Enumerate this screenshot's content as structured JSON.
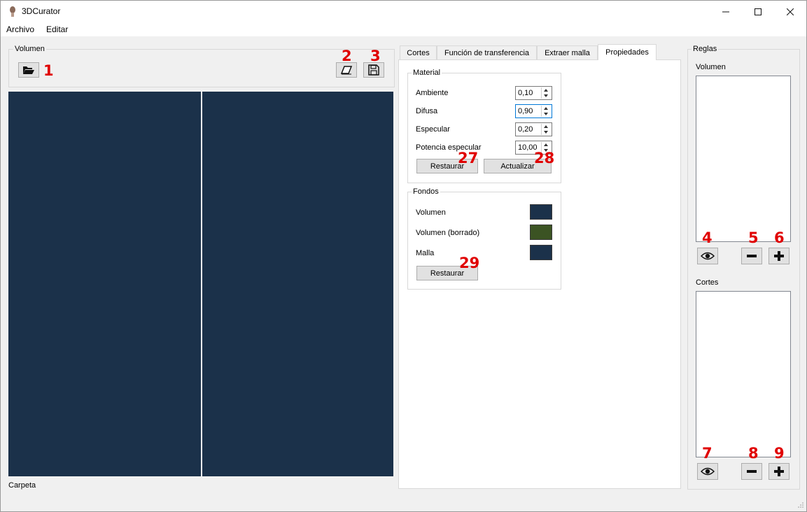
{
  "window": {
    "title": "3DCurator"
  },
  "menu": {
    "items": [
      "Archivo",
      "Editar"
    ]
  },
  "left": {
    "group_title": "Volumen",
    "status": "Carpeta",
    "annotations": {
      "open": "1",
      "erase": "2",
      "save": "3"
    }
  },
  "tabs": [
    "Cortes",
    "Función de transferencia",
    "Extraer malla",
    "Propiedades"
  ],
  "active_tab": "Propiedades",
  "material": {
    "title": "Material",
    "rows": [
      {
        "label": "Ambiente",
        "value": "0,10"
      },
      {
        "label": "Difusa",
        "value": "0,90"
      },
      {
        "label": "Especular",
        "value": "0,20"
      },
      {
        "label": "Potencia especular",
        "value": "10,00"
      }
    ],
    "restore_label": "Restaurar",
    "update_label": "Actualizar",
    "annotations": {
      "restore": "27",
      "update": "28"
    }
  },
  "fondos": {
    "title": "Fondos",
    "rows": [
      {
        "label": "Volumen",
        "color": "#1b314a"
      },
      {
        "label": "Volumen (borrado)",
        "color": "#3b5323"
      },
      {
        "label": "Malla",
        "color": "#1b314a"
      }
    ],
    "restore_label": "Restaurar",
    "annotations": {
      "restore": "29"
    }
  },
  "rules": {
    "title": "Reglas",
    "volume_title": "Volumen",
    "cuts_title": "Cortes",
    "volume_annotations": {
      "eye": "4",
      "minus": "5",
      "plus": "6"
    },
    "cuts_annotations": {
      "eye": "7",
      "minus": "8",
      "plus": "9"
    }
  },
  "colors": {
    "viewport": "#1b314a",
    "annotation": "#e00000"
  }
}
